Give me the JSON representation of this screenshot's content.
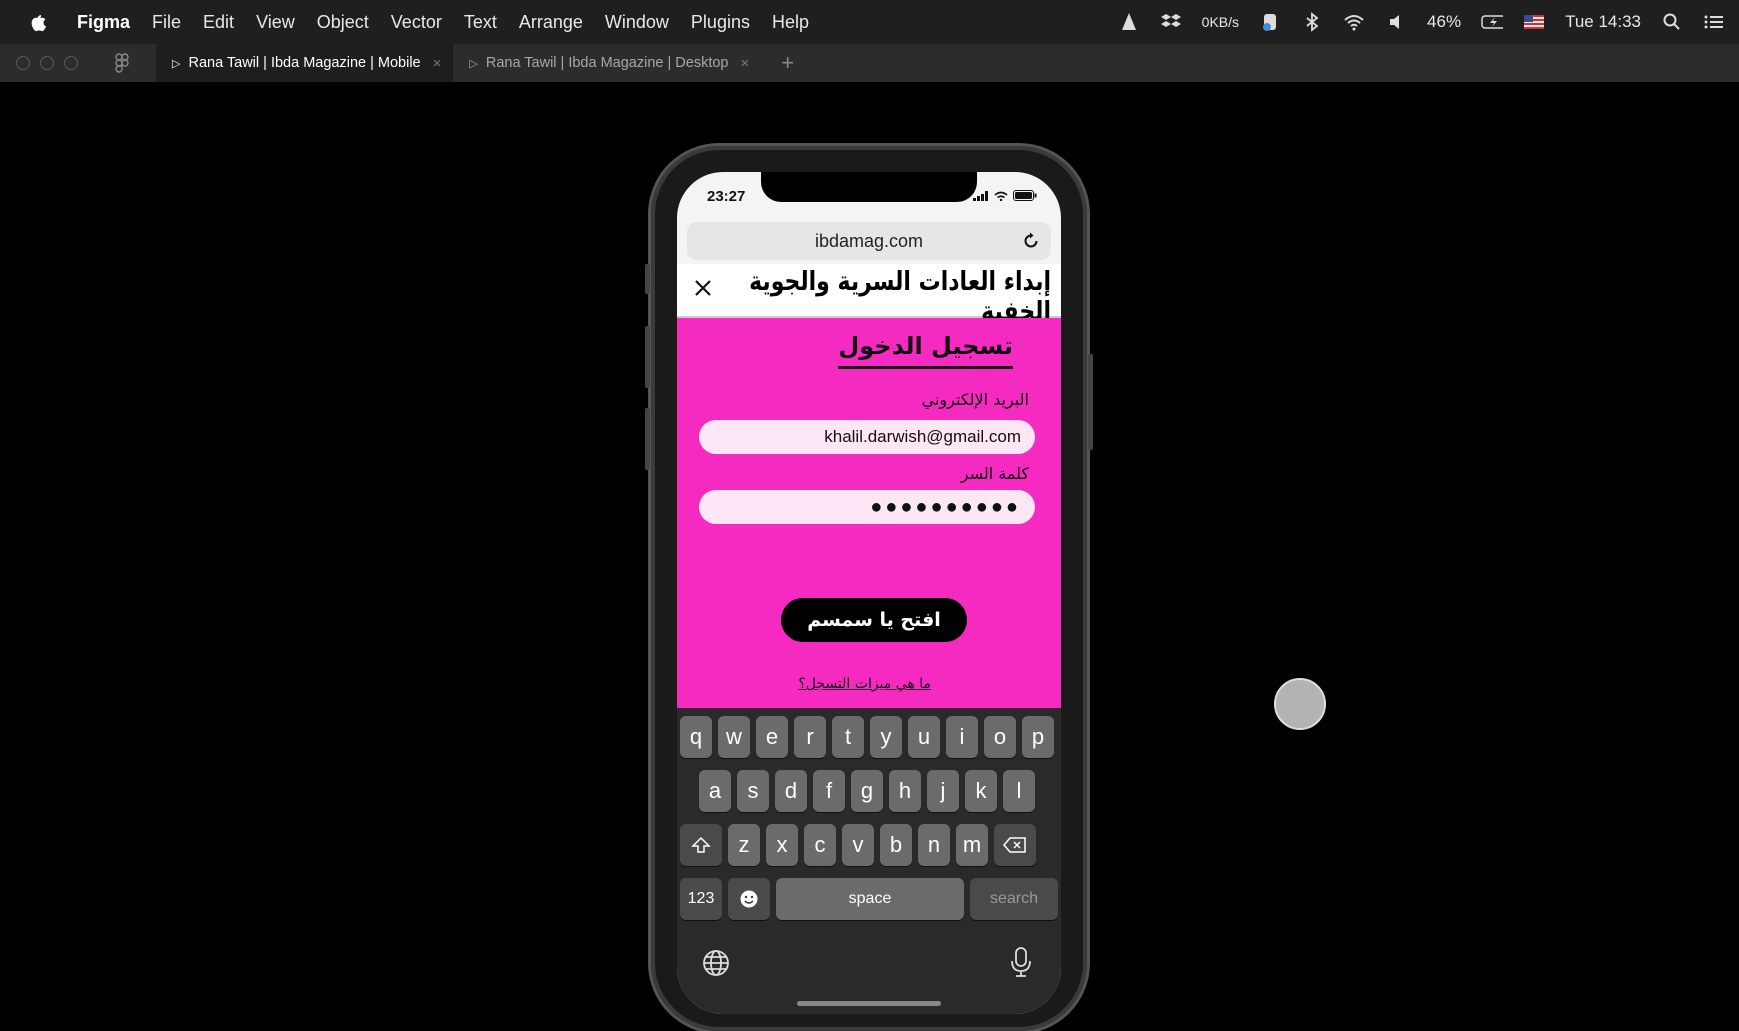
{
  "menubar": {
    "app_name": "Figma",
    "items": [
      "File",
      "Edit",
      "View",
      "Object",
      "Vector",
      "Text",
      "Arrange",
      "Window",
      "Plugins",
      "Help"
    ],
    "network": "0KB/s",
    "battery": "46%",
    "clock": "Tue 14:33"
  },
  "tabs": {
    "active": "Rana Tawil | Ibda Magazine | Mobile",
    "second": "Rana Tawil | Ibda Magazine | Desktop"
  },
  "phone": {
    "time": "23:27",
    "url": "ibdamag.com",
    "site_logo": "إبداء العادات السرية والجوية الخفية",
    "login_title": "تسجيل الدخول",
    "email_label": "البريد الإلكتروني",
    "email_value": "khalil.darwish@gmail.com",
    "password_label": "كلمة السر",
    "password_value": "●●●●●●●●●●",
    "submit_label": "افتح يا سمسم",
    "features_link": "ما هي ميزات التسجل؟",
    "pink_color": "#f52ac0"
  },
  "keyboard": {
    "row1": [
      "q",
      "w",
      "e",
      "r",
      "t",
      "y",
      "u",
      "i",
      "o",
      "p"
    ],
    "row2": [
      "a",
      "s",
      "d",
      "f",
      "g",
      "h",
      "j",
      "k",
      "l"
    ],
    "row3": [
      "z",
      "x",
      "c",
      "v",
      "b",
      "n",
      "m"
    ],
    "num_label": "123",
    "space_label": "space",
    "search_label": "search"
  }
}
